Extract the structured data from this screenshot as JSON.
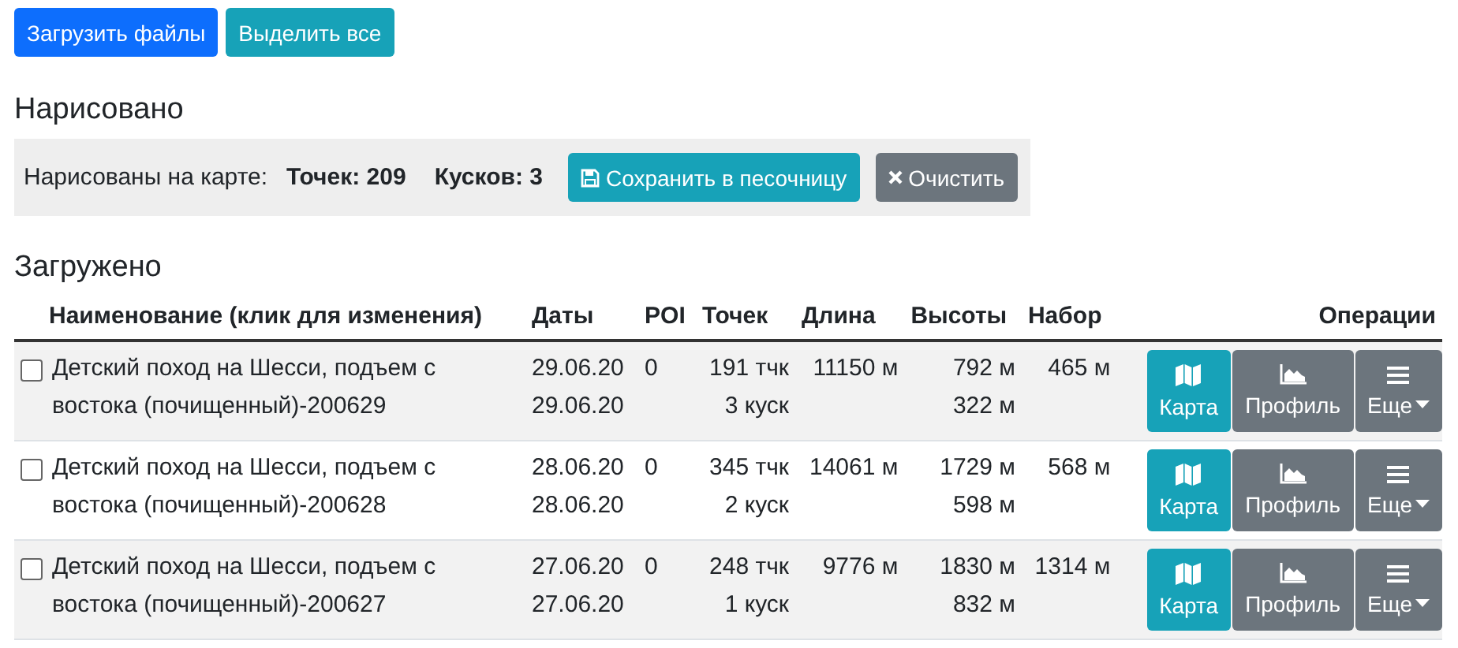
{
  "top_buttons": [
    {
      "label": "Загрузить файлы",
      "kind": "primary"
    },
    {
      "label": "Выделить все",
      "kind": "info"
    }
  ],
  "drawn": {
    "heading": "Нарисовано",
    "label": "Нарисованы на карте:",
    "points": "Точек: 209",
    "pieces": "Кусков: 3",
    "save_button": "Сохранить в песочницу",
    "clear_button": "Очистить"
  },
  "loaded": {
    "heading": "Загружено",
    "columns": [
      "Наименование (клик для изменения)",
      "Даты",
      "POI",
      "Точек",
      "Длина",
      "Высоты",
      "Набор",
      "Операции"
    ],
    "rows": [
      {
        "checked": false,
        "name": "Детский поход на Шесси, подъем с востока (почищенный)-200629",
        "date_start": "29.06.20",
        "date_end": "29.06.20",
        "poi": "0",
        "points": "191 тчк",
        "pieces": "3 куск",
        "length": "11150 м",
        "alt_max": "792 м",
        "alt_min": "322 м",
        "gain": "465 м",
        "ops": [
          "Карта",
          "Профиль",
          "Еще"
        ]
      },
      {
        "checked": false,
        "name": "Детский поход на Шесси, подъем с востока (почищенный)-200628",
        "date_start": "28.06.20",
        "date_end": "28.06.20",
        "poi": "0",
        "points": "345 тчк",
        "pieces": "2 куск",
        "length": "14061 м",
        "alt_max": "1729 м",
        "alt_min": "598 м",
        "gain": "568 м",
        "ops": [
          "Карта",
          "Профиль",
          "Еще"
        ]
      },
      {
        "checked": false,
        "name": "Детский поход на Шесси, подъем с востока (почищенный)-200627",
        "date_start": "27.06.20",
        "date_end": "27.06.20",
        "poi": "0",
        "points": "248 тчк",
        "pieces": "1 куск",
        "length": "9776 м",
        "alt_max": "1830 м",
        "alt_min": "832 м",
        "gain": "1314 м",
        "ops": [
          "Карта",
          "Профиль",
          "Еще"
        ]
      }
    ]
  }
}
